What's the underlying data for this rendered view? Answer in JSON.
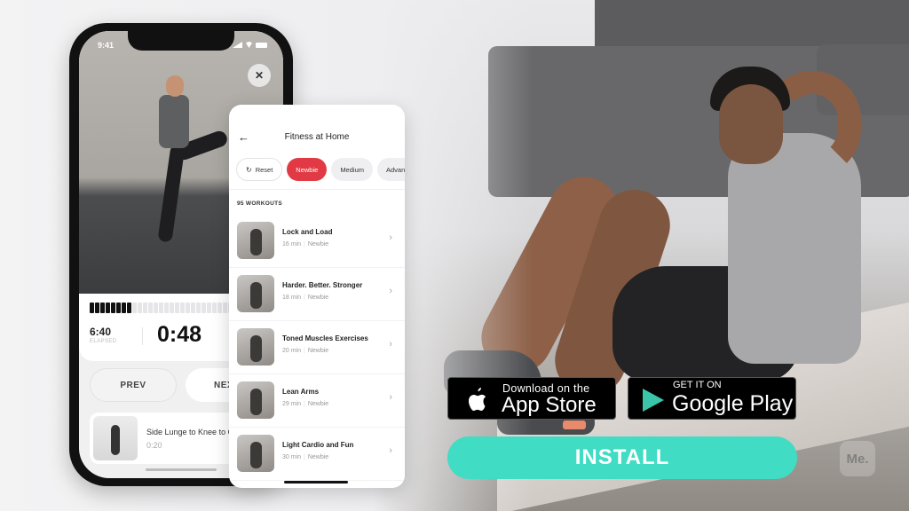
{
  "phone": {
    "status_time": "9:41",
    "close_icon": "close-icon",
    "progress": {
      "completed_segments": 8,
      "total_segments": 30
    },
    "elapsed_value": "6:40",
    "elapsed_label": "ELAPSED",
    "countdown": "0:48",
    "prev_label": "PREV",
    "next_label": "NEXT",
    "next_exercise": {
      "title": "Side Lunge to Knee to Chest",
      "duration": "0:20"
    }
  },
  "panel": {
    "back_icon": "←",
    "title": "Fitness at Home",
    "filters": [
      {
        "label": "Reset",
        "icon": "↻",
        "state": "reset"
      },
      {
        "label": "Newbie",
        "state": "active"
      },
      {
        "label": "Medium",
        "state": "normal"
      },
      {
        "label": "Advanced",
        "state": "normal"
      }
    ],
    "count_label": "95 WORKOUTS",
    "workouts": [
      {
        "title": "Lock and Load",
        "duration": "16 min",
        "level": "Newbie"
      },
      {
        "title": "Harder. Better. Stronger",
        "duration": "18 min",
        "level": "Newbie"
      },
      {
        "title": "Toned Muscles Exercises",
        "duration": "20 min",
        "level": "Newbie"
      },
      {
        "title": "Lean Arms",
        "duration": "29 min",
        "level": "Newbie"
      },
      {
        "title": "Light Cardio and Fun",
        "duration": "30 min",
        "level": "Newbie"
      }
    ]
  },
  "stores": {
    "appstore_small": "Download on the",
    "appstore_big": "App Store",
    "gplay_small": "GET IT ON",
    "gplay_big": "Google Play"
  },
  "install_label": "INSTALL",
  "watermark": "Me.",
  "colors": {
    "accent_red": "#e23a44",
    "install_teal": "#40dcc3"
  }
}
